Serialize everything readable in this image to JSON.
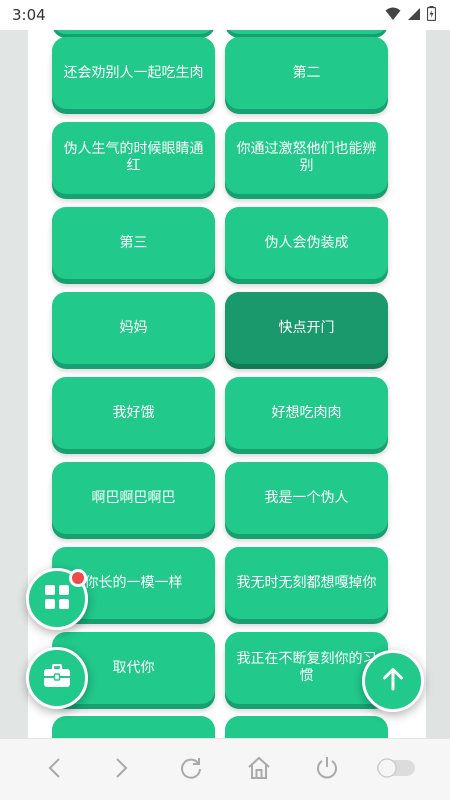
{
  "status_bar": {
    "time": "3:04"
  },
  "buttons": [
    {
      "label": "还会劝别人一起吃生肉",
      "active": false
    },
    {
      "label": "第二",
      "active": false
    },
    {
      "label": "伪人生气的时候眼睛通红",
      "active": false
    },
    {
      "label": "你通过激怒他们也能辨别",
      "active": false
    },
    {
      "label": "第三",
      "active": false
    },
    {
      "label": "伪人会伪装成",
      "active": false
    },
    {
      "label": "妈妈",
      "active": false
    },
    {
      "label": "快点开门",
      "active": true
    },
    {
      "label": "我好饿",
      "active": false
    },
    {
      "label": "好想吃肉肉",
      "active": false
    },
    {
      "label": "啊巴啊巴啊巴",
      "active": false
    },
    {
      "label": "我是一个伪人",
      "active": false
    },
    {
      "label": "你长的一模一样",
      "active": false
    },
    {
      "label": "我无时无刻都想嘎掉你",
      "active": false
    },
    {
      "label": "取代你",
      "active": false
    },
    {
      "label": "我正在不断复刻你的习惯",
      "active": false
    }
  ],
  "floating_buttons": {
    "grid_menu": {
      "icon": "grid-icon",
      "has_badge": true
    },
    "toolbox": {
      "icon": "toolbox-icon"
    },
    "scroll_top": {
      "icon": "arrow-up-icon"
    }
  },
  "colors": {
    "button": "#21c98b",
    "button_shadow": "#17a173",
    "button_active": "#1a9a6c",
    "badge": "#f04b4b"
  },
  "nav_bar": {
    "items": [
      "back-icon",
      "forward-icon",
      "refresh-icon",
      "home-icon",
      "power-icon",
      "toggle-switch"
    ]
  }
}
